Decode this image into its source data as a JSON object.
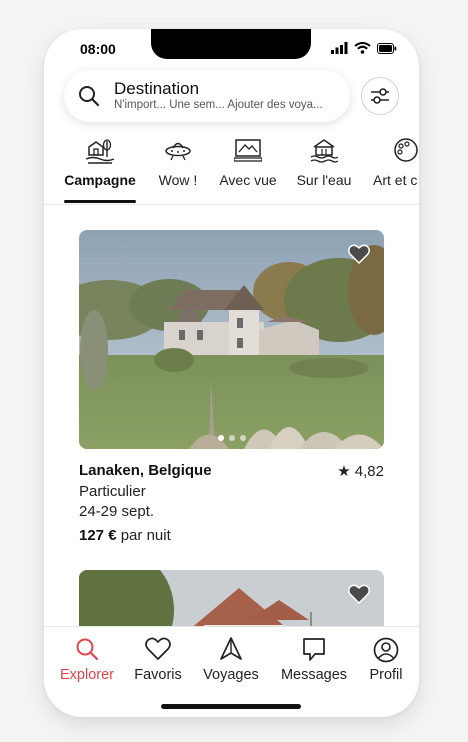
{
  "status_bar": {
    "time": "08:00"
  },
  "search": {
    "title": "Destination",
    "subtitle": "N'import... Une sem... Ajouter des voya..."
  },
  "categories": [
    {
      "label": "Campagne",
      "icon": "countryside-icon",
      "active": true
    },
    {
      "label": "Wow !",
      "icon": "ufo-icon",
      "active": false
    },
    {
      "label": "Avec vue",
      "icon": "view-icon",
      "active": false
    },
    {
      "label": "Sur l'eau",
      "icon": "houseboat-icon",
      "active": false
    },
    {
      "label": "Art et c",
      "icon": "palette-icon",
      "active": false
    }
  ],
  "listing": {
    "location": "Lanaken, Belgique",
    "rating": "★ 4,82",
    "host_type": "Particulier",
    "dates": "24-29 sept.",
    "price": "127 €",
    "price_unit": "par nuit",
    "photo_count": 3,
    "active_photo": 1
  },
  "tabs": [
    {
      "label": "Explorer",
      "icon": "search-icon",
      "active": true
    },
    {
      "label": "Favoris",
      "icon": "heart-icon",
      "active": false
    },
    {
      "label": "Voyages",
      "icon": "navigation-icon",
      "active": false
    },
    {
      "label": "Messages",
      "icon": "message-icon",
      "active": false
    },
    {
      "label": "Profil",
      "icon": "profile-icon",
      "active": false
    }
  ],
  "colors": {
    "accent": "#e0464b",
    "text": "#111111",
    "divider": "#e8e8e8"
  }
}
